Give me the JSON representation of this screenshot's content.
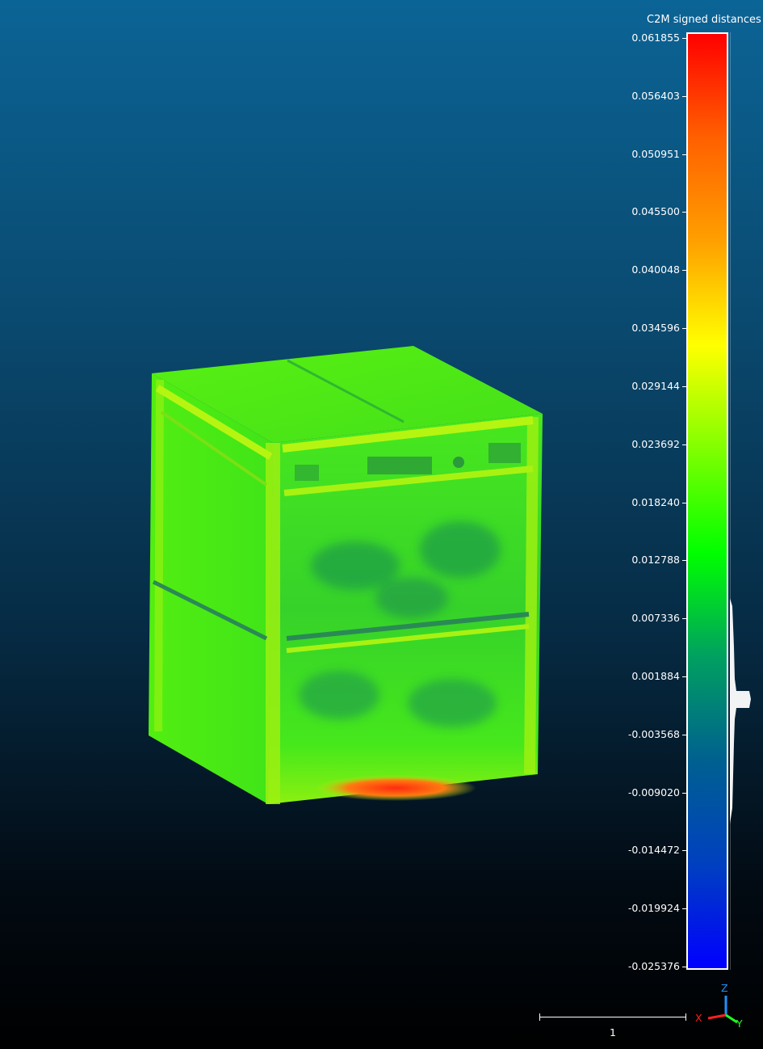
{
  "viewer": {
    "scalar_field_title": "C2M signed distances",
    "colors": {
      "background_top": "#0b6496",
      "background_bottom": "#000000",
      "ramp": [
        "#0000ff",
        "#0040c0",
        "#006090",
        "#00a060",
        "#00ff00",
        "#80ff00",
        "#ffff00",
        "#ffa000",
        "#ff6000",
        "#ff0000"
      ],
      "model_main": "#3be21a",
      "model_highlight": "#b6f511",
      "model_shadow": "#1a9a3a",
      "model_hot": "#ff3a10"
    },
    "scale_ticks": [
      "0.061855",
      "0.056403",
      "0.050951",
      "0.045500",
      "0.040048",
      "0.034596",
      "0.029144",
      "0.023692",
      "0.018240",
      "0.012788",
      "0.007336",
      "0.001884",
      "-0.003568",
      "-0.009020",
      "-0.014472",
      "-0.019924",
      "-0.025376"
    ],
    "scale_bar_label": "1",
    "axis_labels": {
      "x": "X",
      "y": "Y",
      "z": "Z"
    },
    "axis_colors": {
      "x": "#ff2020",
      "y": "#20ff20",
      "z": "#2090ff"
    }
  }
}
